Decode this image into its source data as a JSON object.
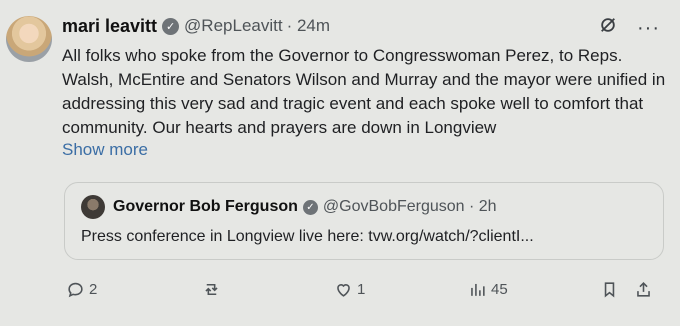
{
  "author": {
    "name": "mari leavitt",
    "handle": "@RepLeavitt",
    "time": "· 24m"
  },
  "post": {
    "text": "All folks who spoke from the Governor to Congresswoman Perez, to Reps. Walsh, McEntire and Senators Wilson and Murray and the mayor were unified in addressing this very sad and tragic event and each spoke well to comfort that community. Our hearts and prayers are down in Longview",
    "show_more": "Show more"
  },
  "quote": {
    "name": "Governor Bob Ferguson",
    "handle": "@GovBobFerguson · 2h",
    "text": "Press conference in Longview live here: tvw.org/watch/?clientI..."
  },
  "actions": {
    "replies": "2",
    "reposts": "",
    "likes": "1",
    "views": "45"
  },
  "icons": {
    "verified": "verified-badge",
    "grok": "grok-icon",
    "more": "more-icon",
    "reply": "reply-icon",
    "repost": "repost-icon",
    "like": "heart-icon",
    "views": "views-icon",
    "bookmark": "bookmark-icon",
    "share": "share-icon"
  },
  "colors": {
    "background": "#e6e7e4",
    "link": "#3b6ea5",
    "muted": "#4f5458"
  }
}
